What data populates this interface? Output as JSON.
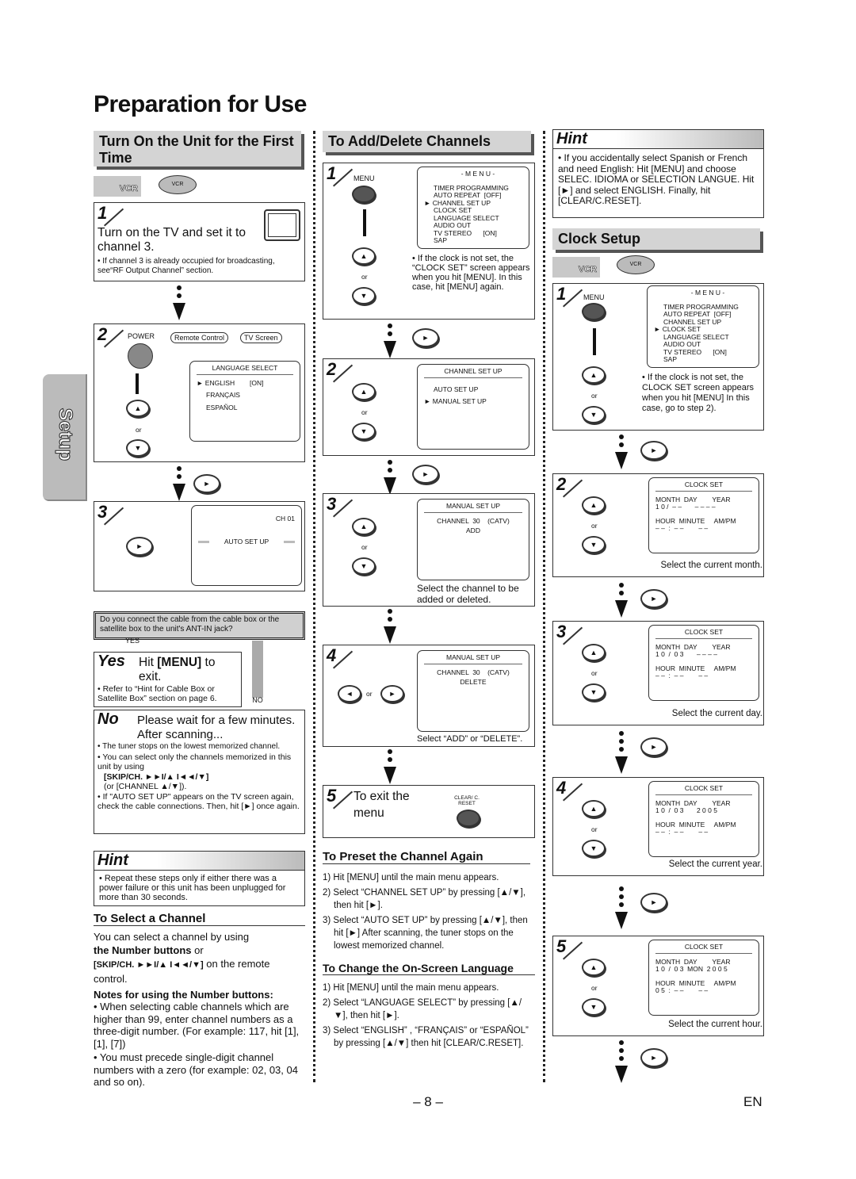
{
  "page": {
    "title": "Preparation for Use",
    "side_tab": "Setup",
    "page_number": "– 8 –",
    "lang": "EN"
  },
  "icons": {
    "vcr_label": "VCR",
    "remote_label": "VCR"
  },
  "common": {
    "or": "or",
    "up": "▲",
    "down": "▼",
    "right": "►",
    "left": "◄",
    "arrow": "►"
  },
  "turn_on": {
    "header": "Turn On the Unit for the First Time",
    "step1": {
      "num": "1",
      "text": "Turn on the TV and set it to channel 3.",
      "note": "• If channel 3 is already occupied for broadcasting, see“RF Output Channel” section."
    },
    "step2": {
      "num": "2",
      "power": "POWER",
      "bubble_remote": "Remote Control",
      "bubble_tv": "TV Screen",
      "screen_title": "LANGUAGE SELECT",
      "items": [
        "► ENGLISH        [ON]",
        "FRANÇAIS",
        "ESPAÑOL"
      ]
    },
    "step3": {
      "num": "3",
      "ch": "CH 01",
      "screen_text": "AUTO SET UP"
    },
    "question": "Do you connect the cable from the cable box or the satellite box to the unit's ANT-IN jack?",
    "yes_tag": "YES",
    "no_tag": "NO",
    "yes": {
      "label": "Yes",
      "text_a": "Hit ",
      "text_b": "[MENU]",
      "text_c": " to exit.",
      "note": "• Refer to “Hint for Cable Box or Satellite Box” section on page 6."
    },
    "no": {
      "label": "No",
      "text": "Please wait for a few minutes. After scanning...",
      "notes": [
        "• The tuner stops on the lowest memorized channel.",
        "• You can select only the channels memorized in this unit by using",
        "[SKIP/CH. ►►I/▲  I◄◄/▼]",
        "(or [CHANNEL ▲/▼]).",
        "• If \"AUTO SET UP\" appears on the TV screen again, check the cable connections. Then, hit [►] once again."
      ]
    },
    "hint": {
      "label": "Hint",
      "text": "• Repeat these steps only if either there was a power failure or this unit has been unplugged for more than 30 seconds."
    }
  },
  "select_channel": {
    "header": "To Select a Channel",
    "p1": "You can select a channel by using",
    "p2": "the Number buttons",
    "p3": " or",
    "p4": "[SKIP/CH. ►►I/▲  I◄◄/▼]",
    "p5": " on the remote control.",
    "notes_title": "Notes for using the Number buttons:",
    "notes": [
      "• When selecting cable channels which are higher than 99, enter channel numbers as a three-digit number. (For example: 117, hit [1], [1], [7])",
      "• You must precede single-digit channel numbers with a zero (for example: 02, 03, 04 and so on)."
    ]
  },
  "add_delete": {
    "header": "To Add/Delete Channels",
    "step1": {
      "num": "1",
      "menu": "MENU",
      "screen_title": "- M E N U -",
      "items": [
        "TIMER PROGRAMMING",
        "AUTO REPEAT  [OFF]",
        "► CHANNEL SET UP",
        "CLOCK SET",
        "LANGUAGE SELECT",
        "AUDIO OUT",
        "TV STEREO      [ON]",
        "SAP"
      ],
      "note": "• If the clock is not set, the “CLOCK SET” screen appears when you hit [MENU]. In this case, hit [MENU] again."
    },
    "step2": {
      "num": "2",
      "screen_title": "CHANNEL SET UP",
      "items": [
        "AUTO SET UP",
        "► MANUAL SET UP"
      ]
    },
    "step3": {
      "num": "3",
      "screen_title": "MANUAL SET UP",
      "line": "CHANNEL  30    (CATV)",
      "flash": "ADD",
      "caption": "Select the channel to be added or deleted."
    },
    "step4": {
      "num": "4",
      "screen_title": "MANUAL SET UP",
      "line": "CHANNEL  30    (CATV)",
      "flash": "DELETE",
      "caption": "Select “ADD” or “DELETE”."
    },
    "step5": {
      "num": "5",
      "text": "To exit the menu",
      "button": "CLEAR/ C. RESET"
    }
  },
  "preset": {
    "header": "To Preset the Channel Again",
    "items": [
      "1) Hit [MENU] until the main menu appears.",
      "2) Select “CHANNEL SET UP” by pressing [▲/▼], then hit [►].",
      "3) Select “AUTO SET UP” by pressing [▲/▼], then hit [►] After scanning, the tuner stops on the lowest memorized channel."
    ]
  },
  "language": {
    "header": "To Change the On-Screen Language",
    "items": [
      "1) Hit [MENU] until the main menu appears.",
      "2) Select “LANGUAGE SELECT” by pressing [▲/▼], then hit [►].",
      "3) Select “ENGLISH” , “FRANÇAIS” or “ESPAÑOL” by pressing [▲/▼] then hit [CLEAR/C.RESET]."
    ]
  },
  "hint_top": {
    "label": "Hint",
    "text": "• If you accidentally select Spanish or French and need English: Hit [MENU] and choose SELEC. IDIOMA or SELECTION LANGUE. Hit [►] and select ENGLISH. Finally, hit [CLEAR/C.RESET]."
  },
  "clock": {
    "header": "Clock Setup",
    "step1": {
      "num": "1",
      "menu": "MENU",
      "screen_title": "- M E N U -",
      "items": [
        "TIMER PROGRAMMING",
        "AUTO REPEAT  [OFF]",
        "CHANNEL SET UP",
        "► CLOCK SET",
        "LANGUAGE SELECT",
        "AUDIO OUT",
        "TV STEREO      [ON]",
        "SAP"
      ],
      "note": "• If the clock is not set, the CLOCK SET screen appears when you hit [MENU] In this case, go to step 2)."
    },
    "labels": {
      "title": "CLOCK SET",
      "row1": "MONTH  DAY        YEAR",
      "row2": "HOUR  MINUTE     AM/PM"
    },
    "steps": [
      {
        "num": "2",
        "v1": "1 0 /  – –       – – – –",
        "v2": "– –  :  – –        – –",
        "caption": "Select the current month."
      },
      {
        "num": "3",
        "v1": "1 0  /  0 3       – – – –",
        "v2": "– –  :  – –        – –",
        "caption": "Select the current day."
      },
      {
        "num": "4",
        "v1": "1 0  /  0 3       2 0 0 5",
        "v2": "– –  :  – –        – –",
        "caption": "Select the current year."
      },
      {
        "num": "5",
        "v1": "1 0  /  0 3  MON  2 0 0 5",
        "v2": "0 5  :  – –        – –",
        "caption": "Select the current hour."
      }
    ]
  }
}
